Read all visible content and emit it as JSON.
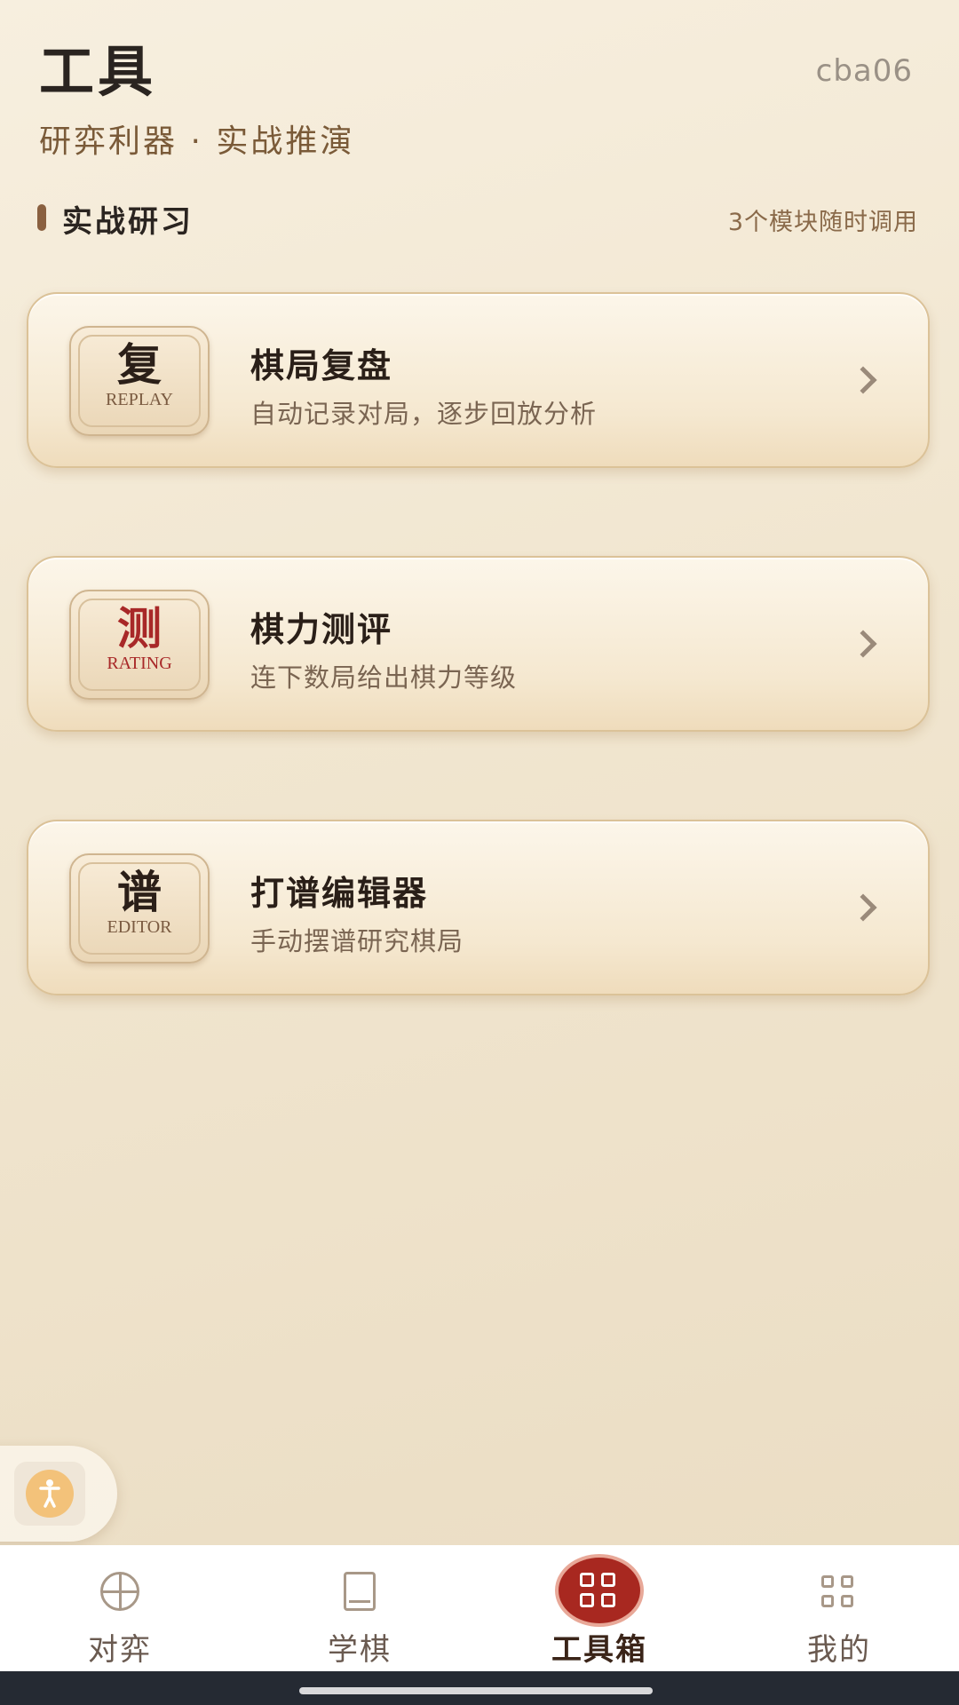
{
  "header": {
    "title": "工具",
    "user_id": "cba06",
    "subtitle": "研弈利器 · 实战推演"
  },
  "section": {
    "title": "实战研习",
    "meta": "3个模块随时调用"
  },
  "tools": [
    {
      "icon_char": "复",
      "icon_en": "REPLAY",
      "title": "棋局复盘",
      "desc": "自动记录对局，逐步回放分析"
    },
    {
      "icon_char": "测",
      "icon_en": "RATING",
      "title": "棋力测评",
      "desc": "连下数局给出棋力等级",
      "accent": "#a82828"
    },
    {
      "icon_char": "谱",
      "icon_en": "EDITOR",
      "title": "打谱编辑器",
      "desc": "手动摆谱研究棋局"
    }
  ],
  "tabbar": {
    "active_index": 2,
    "items": [
      {
        "label": "对弈",
        "icon": "globe-icon"
      },
      {
        "label": "学棋",
        "icon": "book-icon"
      },
      {
        "label": "工具箱",
        "icon": "grid-icon"
      },
      {
        "label": "我的",
        "icon": "grid-icon"
      }
    ]
  },
  "colors": {
    "accent": "#a82820",
    "background": "#f1e6d0",
    "accessibility_button": "#f3c27a"
  }
}
